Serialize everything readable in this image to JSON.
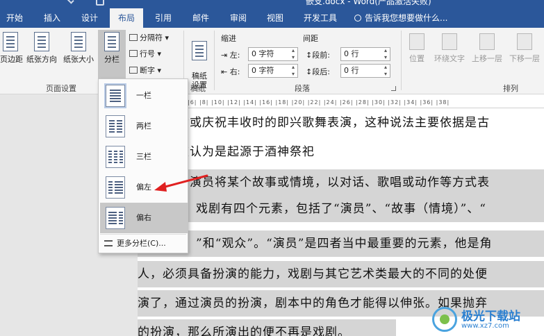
{
  "titlebar": {
    "doc_title": "嵌支.docx - Word(产品激活失败)"
  },
  "tabs": [
    "开始",
    "插入",
    "设计",
    "布局",
    "引用",
    "邮件",
    "审阅",
    "视图",
    "开发工具"
  ],
  "active_tab": "布局",
  "tell_me": "告诉我您想要做什么...",
  "ribbon": {
    "page_setup": {
      "margins": "页边距",
      "orientation": "纸张方向",
      "size": "纸张大小",
      "columns": "分栏",
      "breaks": "分隔符",
      "line_numbers": "行号",
      "hyphenation": "断字",
      "group_label": "页面设置"
    },
    "manuscript": {
      "button": "稿纸\n设置",
      "group_label": "稿纸"
    },
    "paragraph": {
      "indent_header": "缩进",
      "spacing_header": "间距",
      "indent_left_label": "左:",
      "indent_left_value": "0 字符",
      "indent_right_label": "右:",
      "indent_right_value": "0 字符",
      "spacing_before_label": "段前:",
      "spacing_before_value": "0 行",
      "spacing_after_label": "段后:",
      "spacing_after_value": "0 行",
      "group_label": "段落"
    },
    "arrange": {
      "position": "位置",
      "wrap_text": "环绕文字",
      "bring_forward": "上移一层",
      "send_backward": "下移一层",
      "group_label": "排列"
    }
  },
  "ruler_text": "|6| |8| |10| |12| |14| |16| |18| |20| |22| |24| |26| |28| |30| |32| |34| |36| |38|",
  "columns_menu": {
    "options": [
      "一栏",
      "两栏",
      "三栏",
      "偏左",
      "偏右"
    ],
    "more": "更多分栏(C)..."
  },
  "document": {
    "lines": [
      "动或庆祝丰收时的即兴歌舞表演，这种说法主要依据是古",
      "被认为是起源于酒神祭祀",
      "由演员将某个故事或情境，以对话、歌唱或动作等方式表",
      "戏剧有四个元素，包括了“演员”、“故事（情境）”、“",
      "”和“观众”。“演员”是四者当中最重要的元素，他是角",
      "人，必须具备扮演的能力，戏剧与其它艺术类最大的不同的处便",
      "演了，通过演员的扮演，剧本中的角色才能得以伸张。如果抛弃",
      "的扮演，那么所演出的便不再是戏剧。"
    ]
  },
  "watermark": {
    "line1": "极光下载站",
    "line2": "www.xz7.com"
  }
}
